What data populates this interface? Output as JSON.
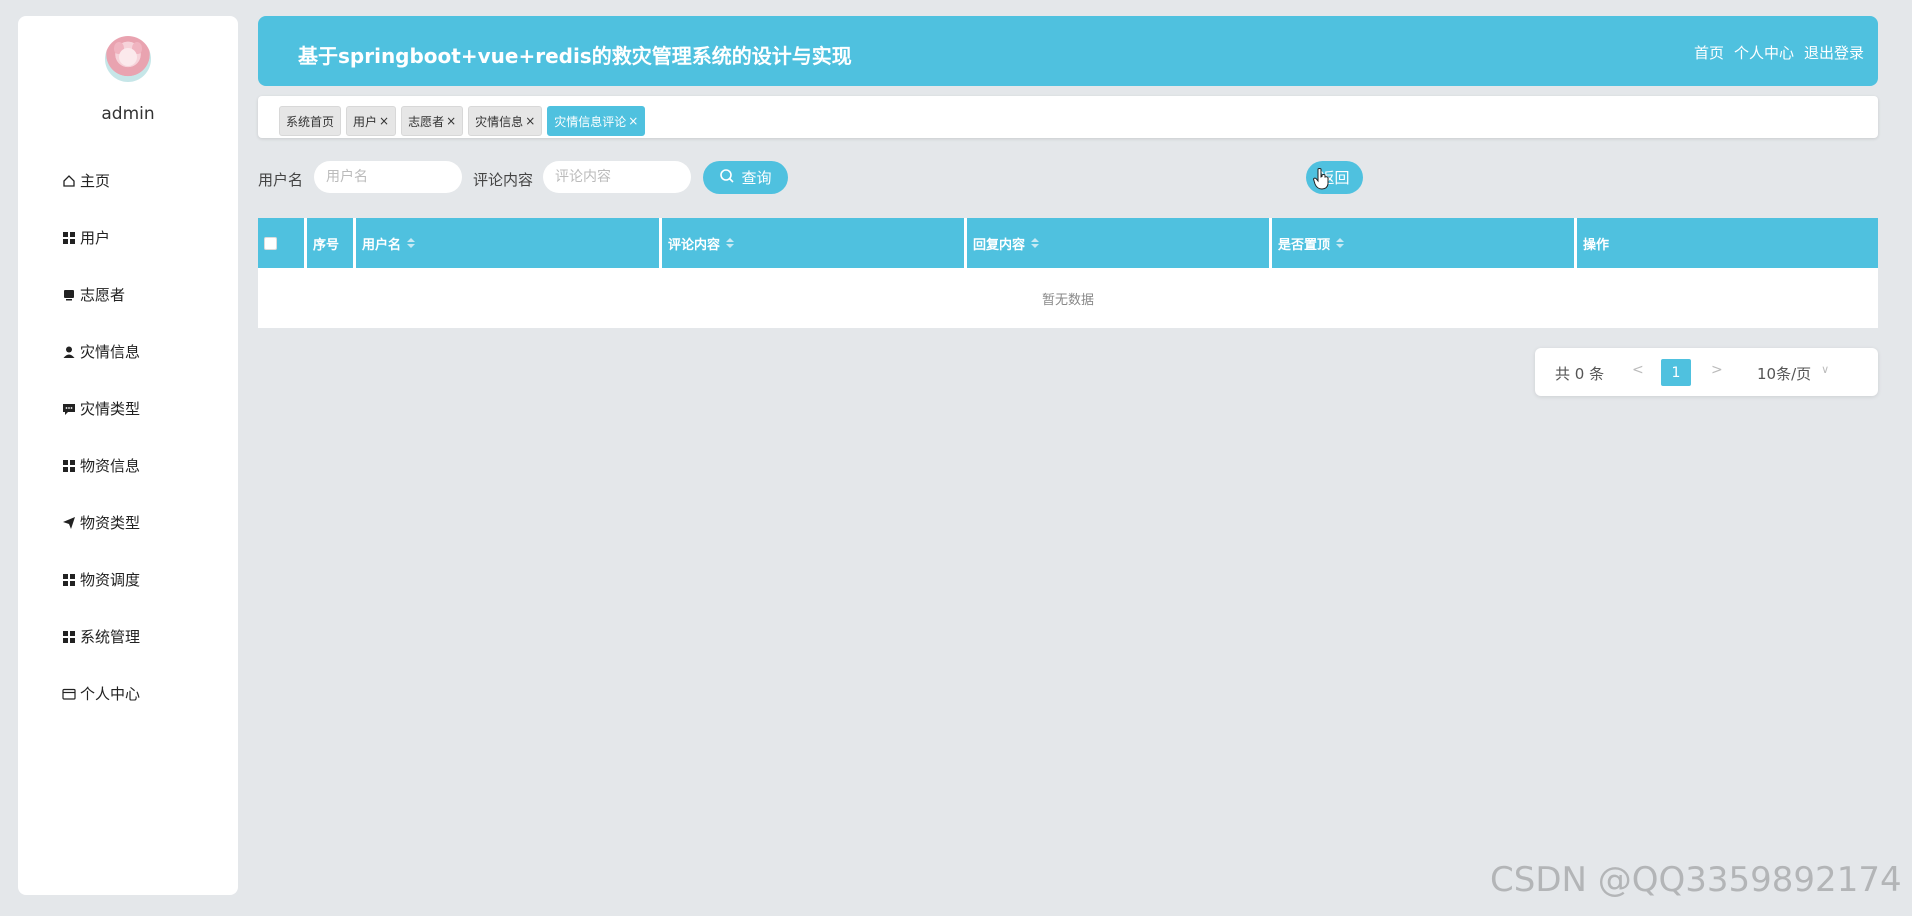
{
  "sidebar": {
    "username": "admin",
    "items": [
      {
        "label": "主页",
        "icon": "home-icon"
      },
      {
        "label": "用户",
        "icon": "grid-icon"
      },
      {
        "label": "志愿者",
        "icon": "monitor-icon"
      },
      {
        "label": "灾情信息",
        "icon": "user-icon"
      },
      {
        "label": "灾情类型",
        "icon": "chat-icon"
      },
      {
        "label": "物资信息",
        "icon": "grid-icon"
      },
      {
        "label": "物资类型",
        "icon": "send-icon"
      },
      {
        "label": "物资调度",
        "icon": "grid-icon"
      },
      {
        "label": "系统管理",
        "icon": "grid-icon"
      },
      {
        "label": "个人中心",
        "icon": "wallet-icon"
      }
    ]
  },
  "header": {
    "title": "基于springboot+vue+redis的救灾管理系统的设计与实现",
    "links": [
      "首页",
      "个人中心",
      "退出登录"
    ]
  },
  "tabs": [
    {
      "label": "系统首页",
      "closable": false
    },
    {
      "label": "用户",
      "closable": true
    },
    {
      "label": "志愿者",
      "closable": true
    },
    {
      "label": "灾情信息",
      "closable": true
    },
    {
      "label": "灾情信息评论",
      "closable": true,
      "active": true
    }
  ],
  "search": {
    "username_label": "用户名",
    "username_placeholder": "用户名",
    "content_label": "评论内容",
    "content_placeholder": "评论内容",
    "query_label": "查询",
    "back_label": "返回"
  },
  "table": {
    "columns": [
      "序号",
      "用户名",
      "评论内容",
      "回复内容",
      "是否置顶",
      "操作"
    ],
    "empty_text": "暂无数据"
  },
  "pagination": {
    "total_text": "共 0 条",
    "prev": "<",
    "page": "1",
    "next": ">",
    "page_size": "10条/页"
  },
  "watermark": "CSDN @QQ3359892174",
  "colors": {
    "accent": "#4fc1df",
    "background": "#e4e7ea"
  }
}
